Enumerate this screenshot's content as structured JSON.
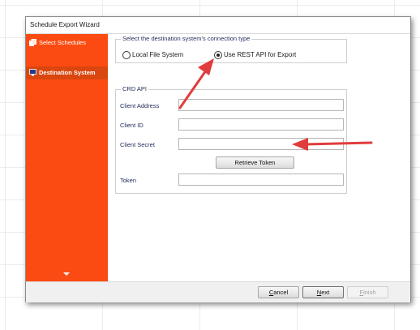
{
  "window": {
    "title": "Schedule Export Wizard"
  },
  "sidebar": {
    "items": [
      {
        "label": "Select Schedules",
        "icon": "pages-icon",
        "active": false
      },
      {
        "label": "Destination System",
        "icon": "monitor-icon",
        "active": true
      }
    ],
    "color": "#fc4b12",
    "active_color": "#d9460f"
  },
  "connection": {
    "group_label": "Select the destination system's connection type",
    "options": [
      {
        "label": "Local File System",
        "selected": false
      },
      {
        "label": "Use REST API for Export",
        "selected": true
      }
    ]
  },
  "crd_api": {
    "group_label": "CRD API",
    "fields": {
      "client_address": {
        "label": "Client Address",
        "value": ""
      },
      "client_id": {
        "label": "Client ID",
        "value": ""
      },
      "client_secret": {
        "label": "Client Secret",
        "value": ""
      },
      "token": {
        "label": "Token",
        "value": ""
      }
    },
    "retrieve_token_label": "Retrieve Token"
  },
  "footer": {
    "cancel": {
      "first": "C",
      "rest": "ancel"
    },
    "next": {
      "first": "N",
      "rest": "ext"
    },
    "finish": {
      "first": "F",
      "rest": "inish"
    }
  },
  "annotation": {
    "arrow_color": "#e03c3c"
  }
}
